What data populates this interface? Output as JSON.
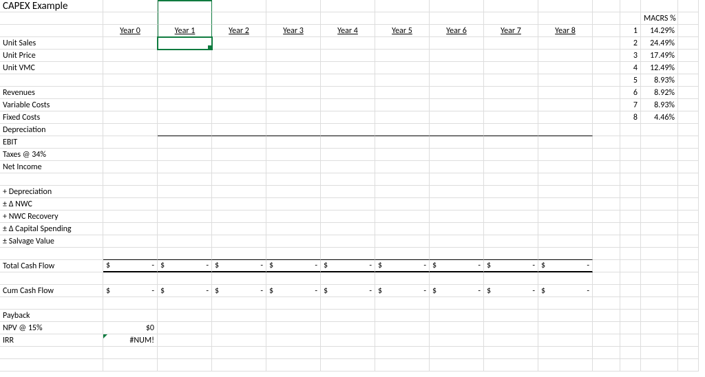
{
  "title": "CAPEX Example",
  "macrs_header": "MACRS %",
  "years": [
    "Year 0",
    "Year 1",
    "Year 2",
    "Year 3",
    "Year 4",
    "Year 5",
    "Year 6",
    "Year 7",
    "Year 8"
  ],
  "row_labels": {
    "unit_sales": "Unit Sales",
    "unit_price": "Unit Price",
    "unit_vmc": "Unit VMC",
    "revenues": "Revenues",
    "variable_costs": "Variable Costs",
    "fixed_costs": "Fixed Costs",
    "depreciation_line": "Depreciation",
    "ebit": "EBIT",
    "taxes": "Taxes @ 34%",
    "net_income": "Net Income",
    "plus_depr": "+ Depreciation",
    "d_nwc": "± Δ NWC",
    "nwc_rec": "+ NWC Recovery",
    "d_capex": "± Δ Capital Spending",
    "salvage": "± Salvage Value",
    "tcf": "Total Cash Flow",
    "ccf": "Cum Cash Flow",
    "payback": "Payback",
    "npv": "NPV @ 15%",
    "irr": "IRR"
  },
  "macrs": [
    {
      "n": "1",
      "pct": "14.29%"
    },
    {
      "n": "2",
      "pct": "24.49%"
    },
    {
      "n": "3",
      "pct": "17.49%"
    },
    {
      "n": "4",
      "pct": "12.49%"
    },
    {
      "n": "5",
      "pct": "8.93%"
    },
    {
      "n": "6",
      "pct": "8.92%"
    },
    {
      "n": "7",
      "pct": "8.93%"
    },
    {
      "n": "8",
      "pct": "4.46%"
    }
  ],
  "money": {
    "d": "$",
    "dash": "-"
  },
  "npv_val": "$0",
  "irr_val": "#NUM!",
  "selected_cell": "Year1 / Unit Sales"
}
